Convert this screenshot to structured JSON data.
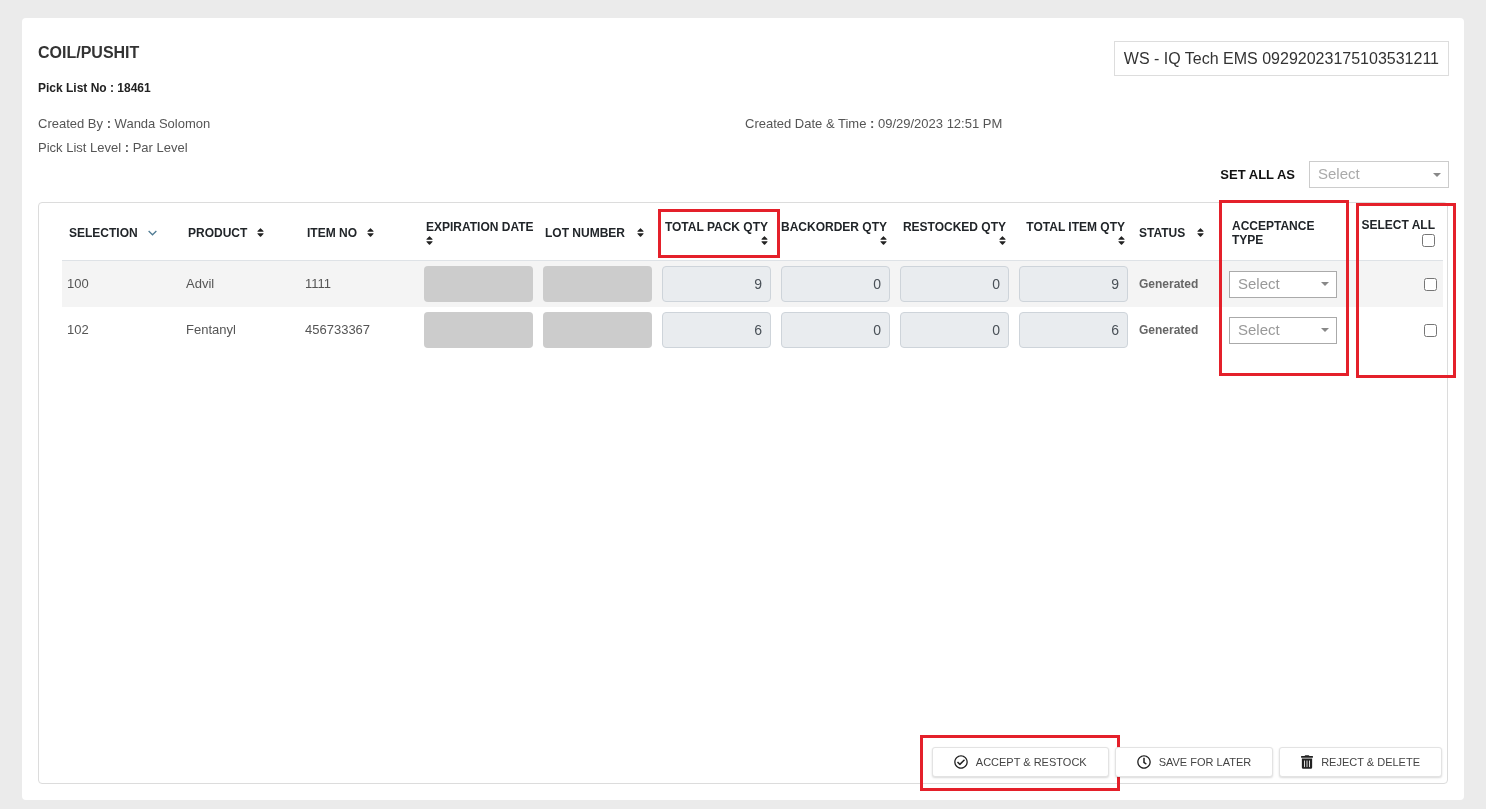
{
  "title": "COIL/PUSHIT",
  "pick_list_no": "Pick List No : 18461",
  "station_field": {
    "value": "WS - IQ Tech EMS 09292023175103531211"
  },
  "details": [
    "Created By **:** Wanda Solomon",
    "Created Date & Time **:** 09/29/2023 12:51 PM",
    "Pick List Level **:** Par Level"
  ],
  "set_all_as": {
    "label": "SET ALL AS",
    "select": {
      "placeholder": "Select"
    }
  },
  "table": {
    "columns": [
      {
        "label": "SELECTION",
        "kind": "text",
        "sortable": true,
        "sorted": true,
        "header_highlighted": false,
        "column_highlighted": false
      },
      {
        "label": "PRODUCT",
        "kind": "text",
        "sortable": true,
        "sorted": false,
        "header_highlighted": false,
        "column_highlighted": false
      },
      {
        "label": "ITEM NO",
        "kind": "text",
        "sortable": true,
        "sorted": false,
        "header_highlighted": false,
        "column_highlighted": false
      },
      {
        "label": "EXPIRATION DATE",
        "kind": "masked",
        "sortable": true,
        "sorted": false,
        "header_highlighted": false,
        "column_highlighted": false
      },
      {
        "label": "LOT NUMBER",
        "kind": "masked",
        "sortable": true,
        "sorted": false,
        "header_highlighted": false,
        "column_highlighted": false
      },
      {
        "label": "TOTAL PACK QTY",
        "kind": "qty",
        "sortable": true,
        "sorted": false,
        "header_highlighted": true,
        "column_highlighted": false
      },
      {
        "label": "BACKORDER QTY",
        "kind": "qty",
        "sortable": true,
        "sorted": false,
        "header_highlighted": false,
        "column_highlighted": false
      },
      {
        "label": "RESTOCKED QTY",
        "kind": "qty",
        "sortable": true,
        "sorted": false,
        "header_highlighted": false,
        "column_highlighted": false
      },
      {
        "label": "TOTAL ITEM QTY",
        "kind": "qty",
        "sortable": true,
        "sorted": false,
        "header_highlighted": false,
        "column_highlighted": false
      },
      {
        "label": "STATUS",
        "kind": "status",
        "sortable": true,
        "sorted": false,
        "header_highlighted": false,
        "column_highlighted": false
      },
      {
        "label": "ACCEPTANCE TYPE",
        "kind": "select",
        "sortable": false,
        "header_highlighted": false,
        "column_highlighted": true
      },
      {
        "label": "SELECT ALL",
        "kind": "checkbox",
        "sortable": false,
        "header_highlighted": false,
        "column_highlighted": true,
        "checked": false
      }
    ],
    "rows": [
      {
        "cells": [
          "100",
          "Advil",
          "1111",
          {
            "masked": true
          },
          {
            "masked": true
          },
          "9",
          "0",
          "0",
          "9",
          "Generated",
          {
            "placeholder": "Select"
          },
          {
            "checked": false
          }
        ]
      },
      {
        "cells": [
          "102",
          "Fentanyl",
          "456733367",
          {
            "masked": true
          },
          {
            "masked": true
          },
          "6",
          "0",
          "0",
          "6",
          "Generated",
          {
            "placeholder": "Select"
          },
          {
            "checked": false
          }
        ]
      }
    ]
  },
  "actions": [
    {
      "label": "ACCEPT & RESTOCK",
      "kind": "accept",
      "highlighted": true
    },
    {
      "label": "SAVE FOR LATER",
      "kind": "save",
      "highlighted": false
    },
    {
      "label": "REJECT & DELETE",
      "kind": "reject",
      "highlighted": false
    }
  ]
}
